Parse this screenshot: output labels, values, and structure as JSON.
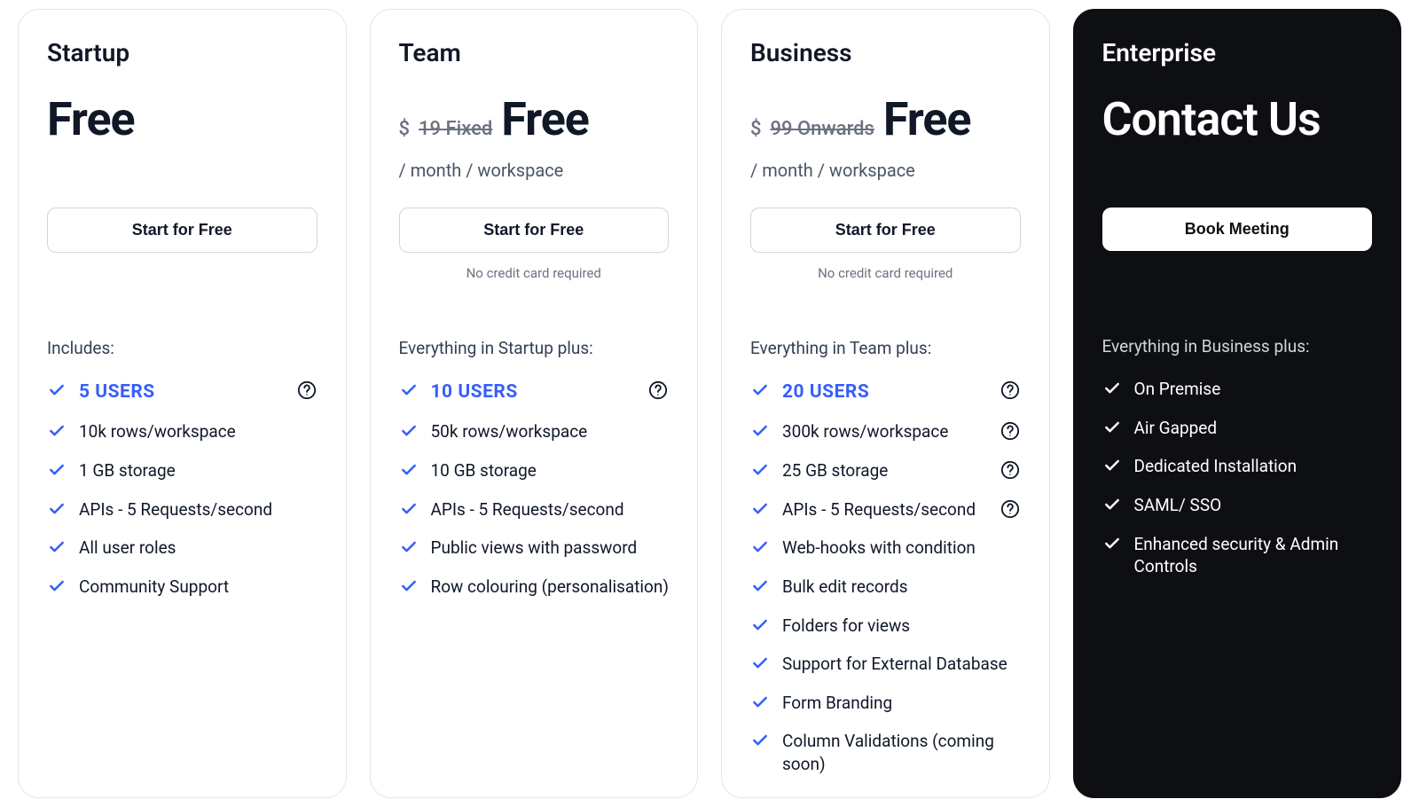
{
  "plans": [
    {
      "name": "Startup",
      "currency": "",
      "strike": "",
      "price": "Free",
      "period": "",
      "cta": "Start for Free",
      "subnote": "",
      "includesLabel": "Includes:",
      "dark": false,
      "features": [
        {
          "label": "5 USERS",
          "highlight": true,
          "help": true
        },
        {
          "label": "10k rows/workspace",
          "highlight": false,
          "help": false
        },
        {
          "label": "1 GB storage",
          "highlight": false,
          "help": false
        },
        {
          "label": "APIs - 5 Requests/second",
          "highlight": false,
          "help": false
        },
        {
          "label": "All user roles",
          "highlight": false,
          "help": false
        },
        {
          "label": "Community Support",
          "highlight": false,
          "help": false
        }
      ]
    },
    {
      "name": "Team",
      "currency": "$",
      "strike": "19 Fixed",
      "price": "Free",
      "period": "/ month / workspace",
      "cta": "Start for Free",
      "subnote": "No credit card required",
      "includesLabel": "Everything in Startup plus:",
      "dark": false,
      "features": [
        {
          "label": "10 USERS",
          "highlight": true,
          "help": true
        },
        {
          "label": "50k rows/workspace",
          "highlight": false,
          "help": false
        },
        {
          "label": "10 GB storage",
          "highlight": false,
          "help": false
        },
        {
          "label": "APIs - 5 Requests/second",
          "highlight": false,
          "help": false
        },
        {
          "label": "Public views with password",
          "highlight": false,
          "help": false
        },
        {
          "label": "Row colouring (personalisation)",
          "highlight": false,
          "help": false
        }
      ]
    },
    {
      "name": "Business",
      "currency": "$",
      "strike": "99 Onwards",
      "price": "Free",
      "period": "/ month / workspace",
      "cta": "Start for Free",
      "subnote": "No credit card required",
      "includesLabel": "Everything in Team plus:",
      "dark": false,
      "features": [
        {
          "label": "20 USERS",
          "highlight": true,
          "help": true
        },
        {
          "label": "300k rows/workspace",
          "highlight": false,
          "help": true
        },
        {
          "label": "25 GB storage",
          "highlight": false,
          "help": true
        },
        {
          "label": "APIs - 5 Requests/second",
          "highlight": false,
          "help": true
        },
        {
          "label": "Web-hooks with condition",
          "highlight": false,
          "help": false
        },
        {
          "label": "Bulk edit records",
          "highlight": false,
          "help": false
        },
        {
          "label": "Folders for views",
          "highlight": false,
          "help": false
        },
        {
          "label": "Support for External Database",
          "highlight": false,
          "help": false
        },
        {
          "label": "Form Branding",
          "highlight": false,
          "help": false
        },
        {
          "label": "Column Validations (coming soon)",
          "highlight": false,
          "help": false
        }
      ]
    },
    {
      "name": "Enterprise",
      "currency": "",
      "strike": "",
      "price": "Contact Us",
      "period": "",
      "cta": "Book Meeting",
      "subnote": "",
      "includesLabel": "Everything in Business plus:",
      "dark": true,
      "features": [
        {
          "label": "On Premise",
          "highlight": false,
          "help": false
        },
        {
          "label": "Air Gapped",
          "highlight": false,
          "help": false
        },
        {
          "label": "Dedicated Installation",
          "highlight": false,
          "help": false
        },
        {
          "label": "SAML/ SSO",
          "highlight": false,
          "help": false
        },
        {
          "label": "Enhanced security & Admin Controls",
          "highlight": false,
          "help": false
        }
      ]
    }
  ]
}
